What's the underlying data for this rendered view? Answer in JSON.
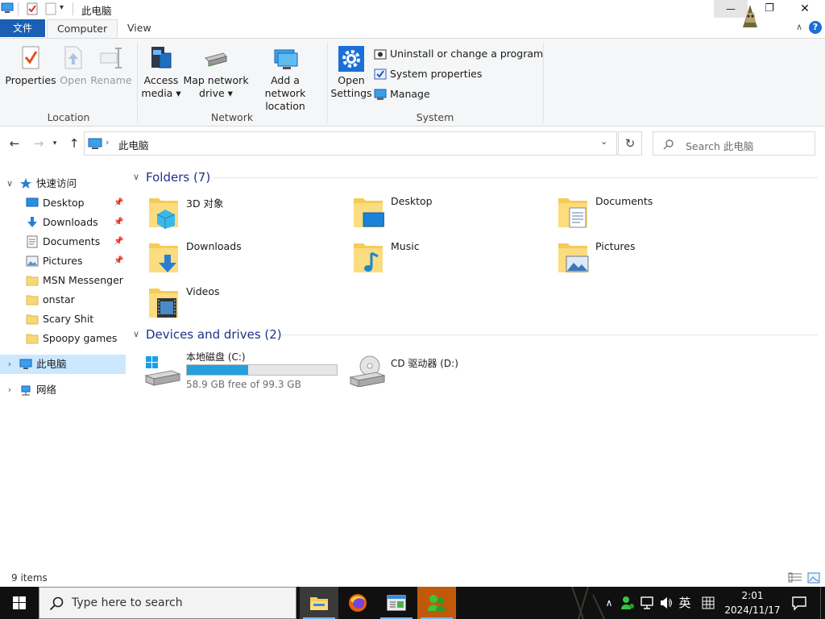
{
  "window": {
    "title": "此电脑",
    "controls": {
      "minimize": "—",
      "restore": "❐",
      "close": "✕"
    }
  },
  "ribbon": {
    "tabs": [
      {
        "label": "文件"
      },
      {
        "label": "Computer"
      },
      {
        "label": "View"
      }
    ],
    "groups": {
      "location": {
        "label": "Location",
        "properties": "Properties",
        "open": "Open",
        "rename": "Rename"
      },
      "network": {
        "label": "Network",
        "access_media_1": "Access",
        "access_media_2": "media ▾",
        "map_drive_1": "Map network",
        "map_drive_2": "drive ▾",
        "add_location_1": "Add a network",
        "add_location_2": "location"
      },
      "system": {
        "label": "System",
        "open_settings_1": "Open",
        "open_settings_2": "Settings",
        "uninstall": "Uninstall or change a program",
        "system_properties": "System properties",
        "manage": "Manage"
      }
    }
  },
  "address": {
    "path": "此电脑",
    "search_placeholder": "Search 此电脑"
  },
  "nav_pane": {
    "quick_access": "快速访问",
    "items": [
      {
        "label": "Desktop",
        "pinned": true
      },
      {
        "label": "Downloads",
        "pinned": true
      },
      {
        "label": "Documents",
        "pinned": true
      },
      {
        "label": "Pictures",
        "pinned": true
      },
      {
        "label": "MSN Messenger",
        "pinned": false
      },
      {
        "label": "onstar",
        "pinned": false
      },
      {
        "label": "Scary Shit",
        "pinned": false
      },
      {
        "label": "Spoopy games",
        "pinned": false
      }
    ],
    "this_pc": "此电脑",
    "network": "网络"
  },
  "content": {
    "folders_header": "Folders (7)",
    "folders": [
      {
        "label": "3D 对象",
        "icon": "3d-objects-icon"
      },
      {
        "label": "Desktop",
        "icon": "desktop-icon"
      },
      {
        "label": "Documents",
        "icon": "documents-icon"
      },
      {
        "label": "Downloads",
        "icon": "downloads-icon"
      },
      {
        "label": "Music",
        "icon": "music-icon"
      },
      {
        "label": "Pictures",
        "icon": "pictures-icon"
      },
      {
        "label": "Videos",
        "icon": "videos-icon"
      }
    ],
    "drives_header": "Devices and drives (2)",
    "drives": [
      {
        "label": "本地磁盘 (C:)",
        "free_text": "58.9 GB free of 99.3 GB",
        "used_fraction": 0.407
      },
      {
        "label": "CD 驱动器 (D:)"
      }
    ]
  },
  "status": {
    "item_count": "9 items"
  },
  "taskbar": {
    "search_placeholder": "Type here to search",
    "ime": "英",
    "time": "2:01",
    "date": "2024/11/17"
  },
  "colors": {
    "accent": "#1a5fb4",
    "selection": "#cce8ff",
    "drive_bar": "#26a0da",
    "section_header": "#1e3287"
  }
}
